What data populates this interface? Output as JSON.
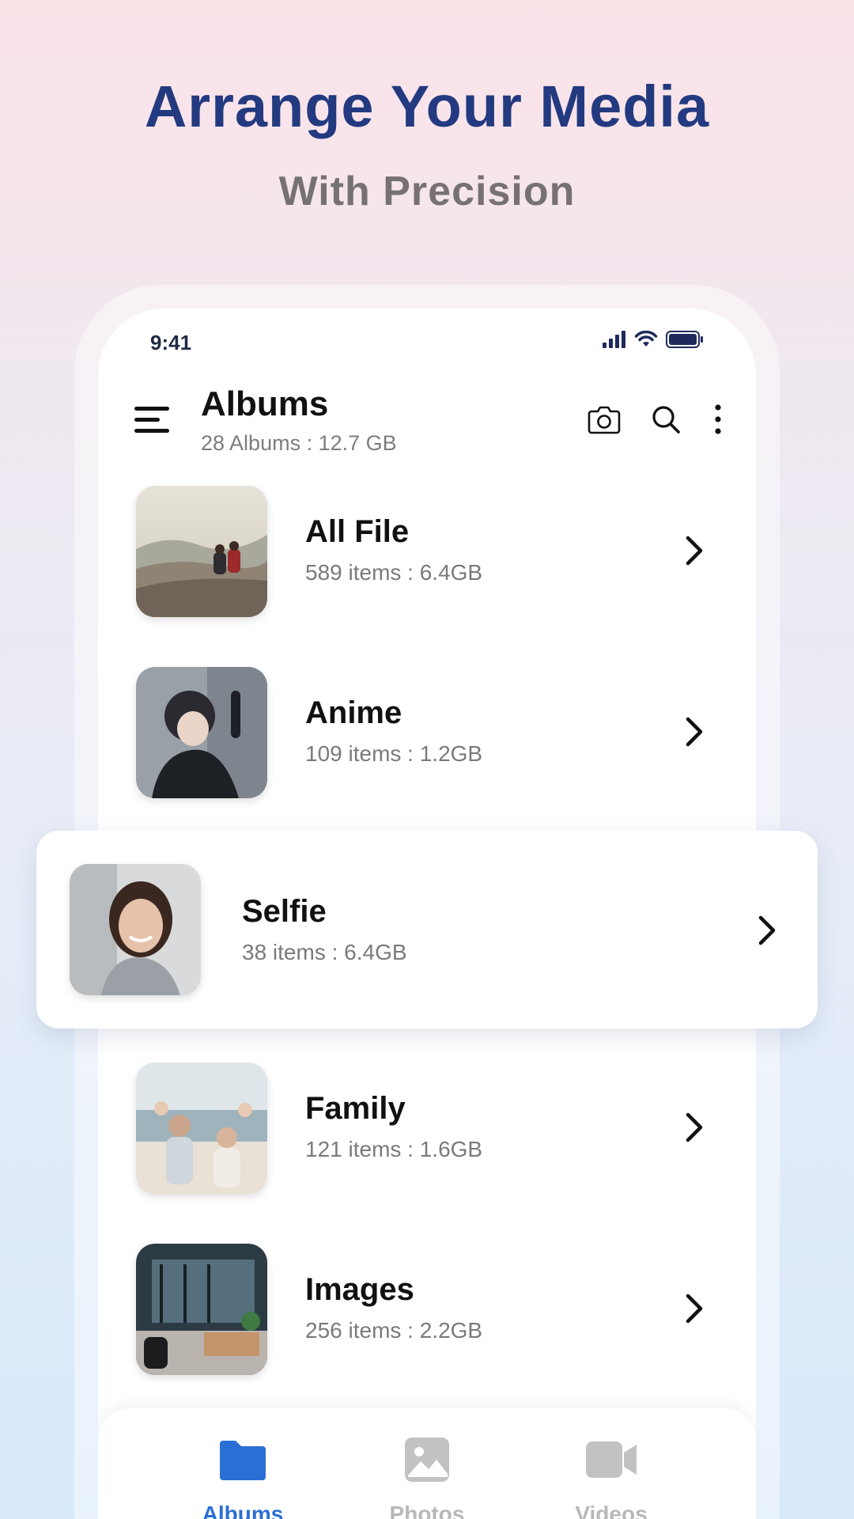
{
  "promo": {
    "headline": "Arrange Your Media",
    "subheadline": "With Precision"
  },
  "status_bar": {
    "time": "9:41"
  },
  "appbar": {
    "title": "Albums",
    "subtitle": "28 Albums  :  12.7 GB"
  },
  "albums": [
    {
      "name": "All File",
      "meta": "589 items  :  6.4GB"
    },
    {
      "name": "Anime",
      "meta": "109 items  :  1.2GB"
    },
    {
      "name": "Selfie",
      "meta": "38 items  :  6.4GB"
    },
    {
      "name": "Family",
      "meta": "121 items  :  1.6GB"
    },
    {
      "name": "Images",
      "meta": "256 items  :  2.2GB"
    }
  ],
  "bottom_nav": [
    {
      "label": "Albums",
      "icon": "folder-icon",
      "active": true
    },
    {
      "label": "Photos",
      "icon": "image-icon",
      "active": false
    },
    {
      "label": "Videos",
      "icon": "video-camera-icon",
      "active": false
    }
  ],
  "colors": {
    "accent": "#2a6fd3",
    "headline": "#233a80",
    "inactive": "#b8b8b8"
  }
}
